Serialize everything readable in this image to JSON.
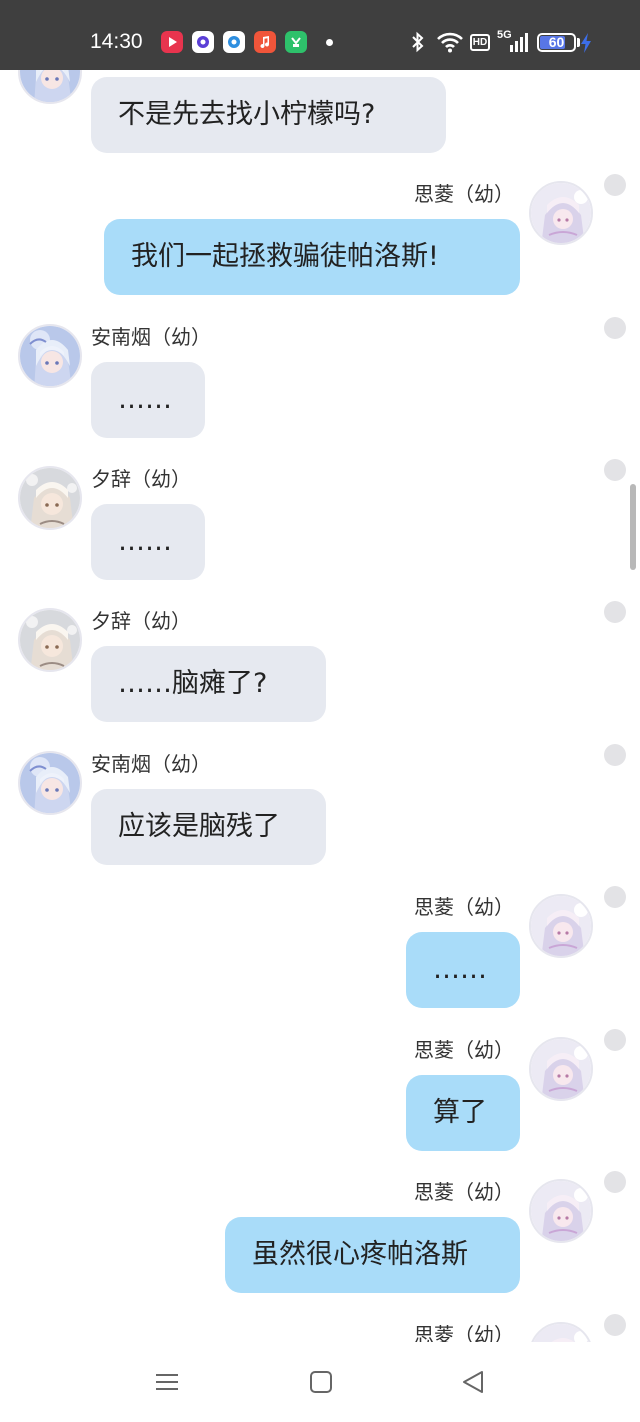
{
  "status_bar": {
    "time": "14:30",
    "app_icons": [
      "video-app-icon",
      "browser-app-icon",
      "message-app-icon",
      "music-app-icon",
      "shopping-app-icon"
    ],
    "system_icons": [
      "bluetooth-icon",
      "wifi-icon",
      "hd-icon",
      "5g-signal-icon"
    ],
    "network": "5G",
    "hd": "HD",
    "battery": "60",
    "charging": true
  },
  "chat": {
    "messages": [
      {
        "side": "in",
        "sender": "",
        "text": "不是先去找小柠檬吗?",
        "avatar": "annanyan-avatar"
      },
      {
        "side": "out",
        "sender": "思菱（幼）",
        "text": "我们一起拯救骗徒帕洛斯!",
        "avatar": "siling-avatar"
      },
      {
        "side": "in",
        "sender": "安南烟（幼）",
        "text": "……",
        "avatar": "annanyan-avatar"
      },
      {
        "side": "in",
        "sender": "夕辞（幼）",
        "text": "……",
        "avatar": "xici-avatar"
      },
      {
        "side": "in",
        "sender": "夕辞（幼）",
        "text": "……脑瘫了?",
        "avatar": "xici-avatar"
      },
      {
        "side": "in",
        "sender": "安南烟（幼）",
        "text": "应该是脑残了",
        "avatar": "annanyan-avatar"
      },
      {
        "side": "out",
        "sender": "思菱（幼）",
        "text": "……",
        "avatar": "siling-avatar"
      },
      {
        "side": "out",
        "sender": "思菱（幼）",
        "text": "算了",
        "avatar": "siling-avatar"
      },
      {
        "side": "out",
        "sender": "思菱（幼）",
        "text": "虽然很心疼帕洛斯",
        "avatar": "siling-avatar"
      },
      {
        "side": "out",
        "sender": "思菱（幼）",
        "text": "",
        "avatar": "siling-avatar"
      }
    ]
  },
  "nav_bar": {
    "buttons": [
      "menu-icon",
      "home-icon",
      "back-icon"
    ]
  },
  "colors": {
    "status_bar_bg": "#3f3f3f",
    "incoming_bubble": "#e6e9f0",
    "outgoing_bubble": "#a9dcf9",
    "battery_fill": "#5876e6"
  }
}
